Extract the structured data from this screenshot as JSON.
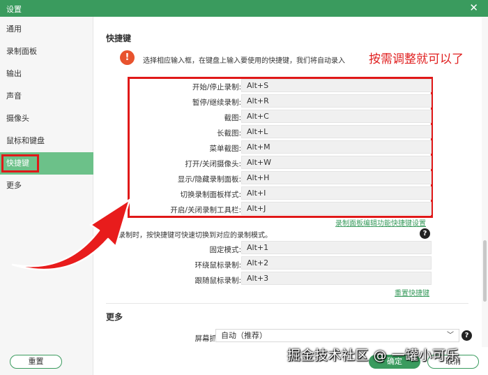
{
  "window": {
    "title": "设置"
  },
  "sidebar": {
    "items": [
      {
        "label": "通用"
      },
      {
        "label": "录制面板"
      },
      {
        "label": "输出"
      },
      {
        "label": "声音"
      },
      {
        "label": "摄像头"
      },
      {
        "label": "鼠标和键盘"
      },
      {
        "label": "快捷键"
      },
      {
        "label": "更多"
      }
    ],
    "active_index": 6
  },
  "shortcuts": {
    "title": "快捷键",
    "hint": "选择相应输入框，在键盘上输入要使用的快捷键，我们将自动录入",
    "annotation": "按需调整就可以了",
    "rows": [
      {
        "label": "开始/停止录制:",
        "value": "Alt+S"
      },
      {
        "label": "暂停/继续录制:",
        "value": "Alt+R"
      },
      {
        "label": "截图:",
        "value": "Alt+C"
      },
      {
        "label": "长截图:",
        "value": "Alt+L"
      },
      {
        "label": "菜单截图:",
        "value": "Alt+M"
      },
      {
        "label": "打开/关闭摄像头:",
        "value": "Alt+W"
      },
      {
        "label": "显示/隐藏录制面板:",
        "value": "Alt+H"
      },
      {
        "label": "切换录制面板样式:",
        "value": "Alt+I"
      },
      {
        "label": "开启/关闭录制工具栏:",
        "value": "Alt+J"
      }
    ],
    "panel_link": "录制面板编辑功能快捷键设置",
    "mode_desc": "录制时，按快捷键可快速切换到对应的录制模式。",
    "mode_rows": [
      {
        "label": "固定模式:",
        "value": "Alt+1"
      },
      {
        "label": "环绕鼠标录制:",
        "value": "Alt+2"
      },
      {
        "label": "跟随鼠标录制:",
        "value": "Alt+3"
      }
    ],
    "reset_link": "重置快捷键"
  },
  "more": {
    "title": "更多",
    "capture_label": "屏幕抓取方式:",
    "capture_value": "自动（推荐）"
  },
  "footer": {
    "reset": "重置",
    "ok": "确定",
    "cancel": "取消",
    "watermark": "掘金技术社区 @ 一罐小可乐"
  },
  "colors": {
    "accent": "#3a9b5e",
    "active": "#6cc189",
    "highlight": "#e01818",
    "warning": "#e8532e"
  },
  "icons": [
    "close-icon",
    "warning-icon",
    "help-icon",
    "chevron-down-icon",
    "red-arrow"
  ]
}
